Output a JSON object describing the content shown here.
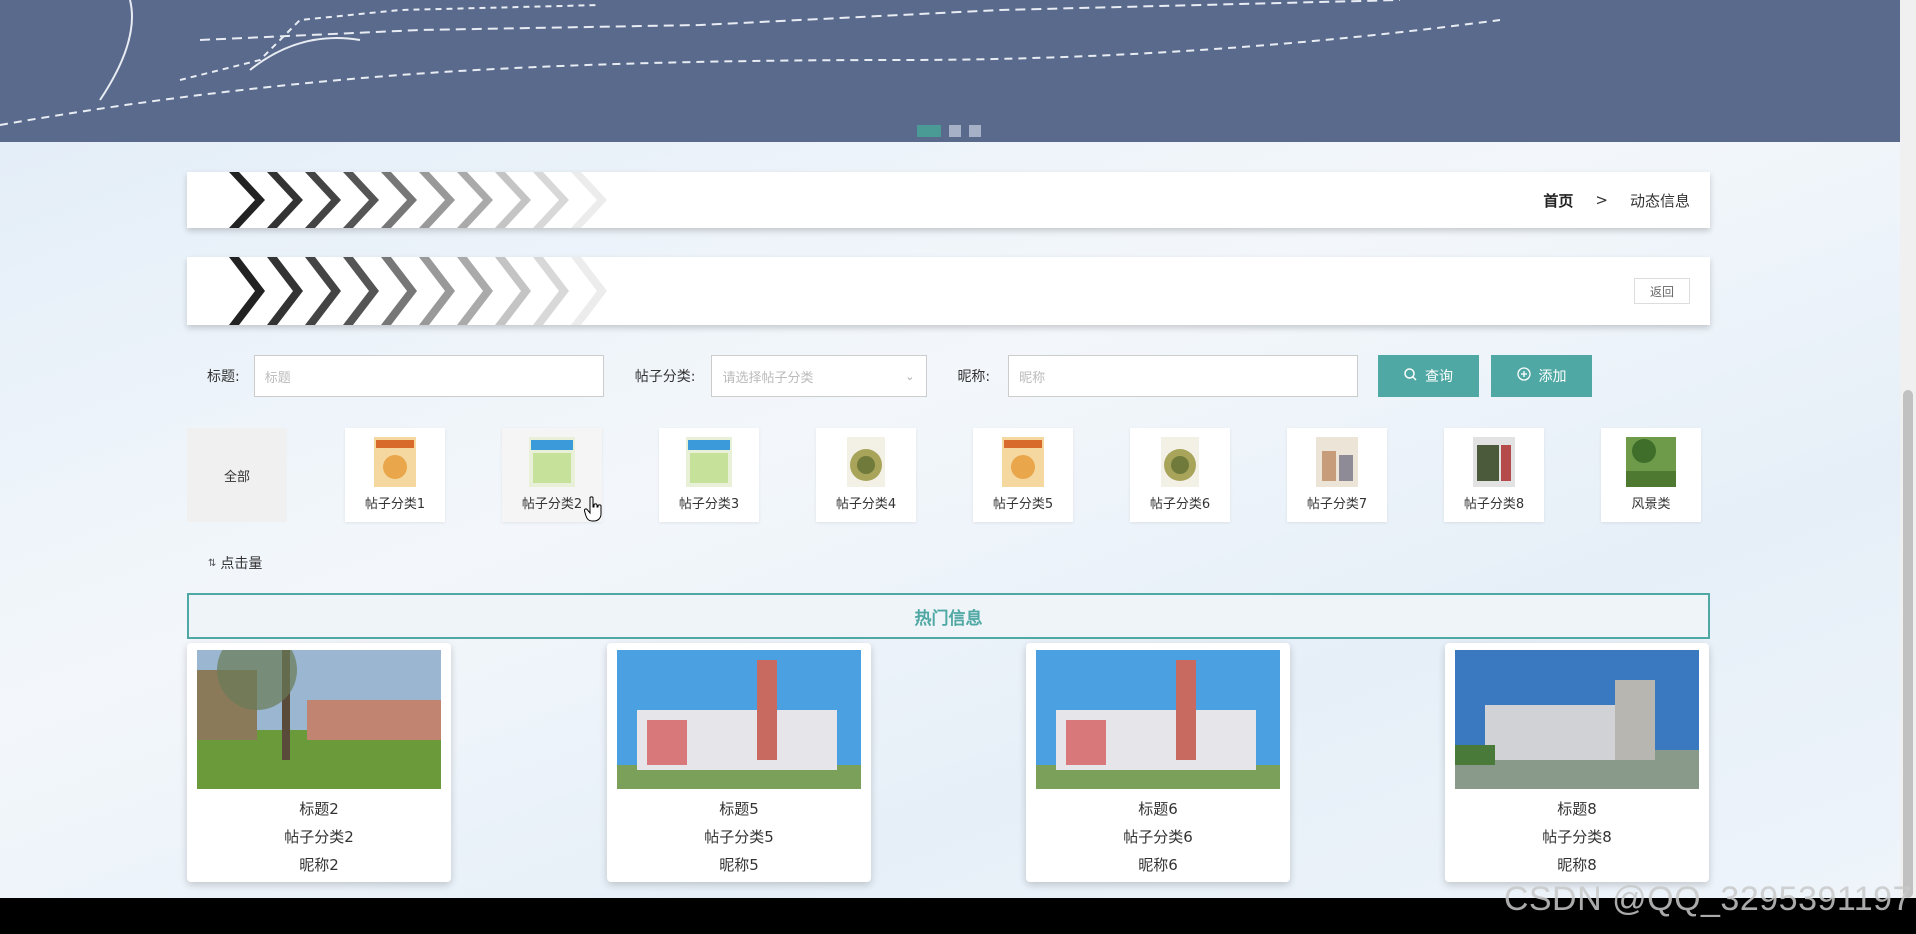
{
  "banner": {
    "slide_count": 3,
    "active_slide": 1
  },
  "breadcrumb": {
    "home": "首页",
    "separator": ">",
    "current": "动态信息"
  },
  "back_button": "返回",
  "search": {
    "title_label": "标题:",
    "title_placeholder": "标题",
    "category_label": "帖子分类:",
    "category_placeholder": "请选择帖子分类",
    "nickname_label": "昵称:",
    "nickname_placeholder": "昵称",
    "query_button": "查询",
    "add_button": "添加"
  },
  "categories": [
    {
      "label": "全部"
    },
    {
      "label": "帖子分类1"
    },
    {
      "label": "帖子分类2"
    },
    {
      "label": "帖子分类3"
    },
    {
      "label": "帖子分类4"
    },
    {
      "label": "帖子分类5"
    },
    {
      "label": "帖子分类6"
    },
    {
      "label": "帖子分类7"
    },
    {
      "label": "帖子分类8"
    },
    {
      "label": "风景类"
    }
  ],
  "sort_label": "点击量",
  "hot_section_title": "热门信息",
  "cards": [
    {
      "title": "标题2",
      "category": "帖子分类2",
      "nickname": "昵称2"
    },
    {
      "title": "标题5",
      "category": "帖子分类5",
      "nickname": "昵称5"
    },
    {
      "title": "标题6",
      "category": "帖子分类6",
      "nickname": "昵称6"
    },
    {
      "title": "标题8",
      "category": "帖子分类8",
      "nickname": "昵称8"
    }
  ],
  "watermark": "CSDN @QQ_3295391197",
  "colors": {
    "accent": "#4fa8a3",
    "banner": "#5a6a8c"
  }
}
